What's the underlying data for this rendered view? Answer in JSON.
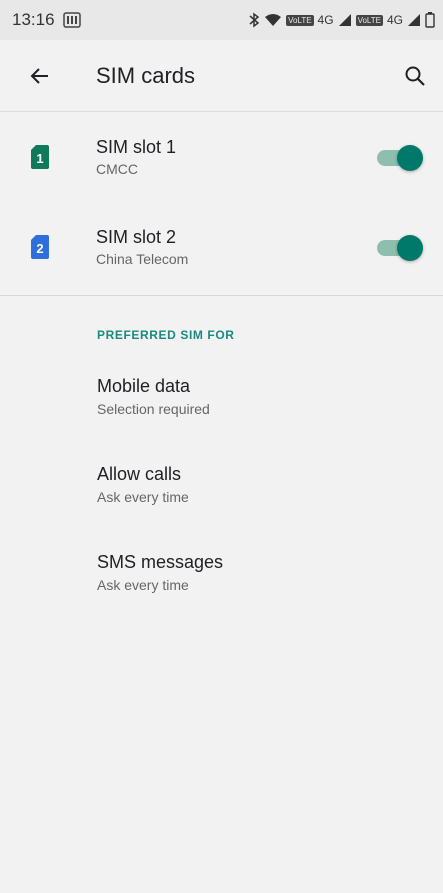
{
  "status_bar": {
    "time": "13:16",
    "network_labels": [
      "4G",
      "4G"
    ],
    "volte_labels": [
      "VoLTE",
      "VoLTE"
    ]
  },
  "app_bar": {
    "title": "SIM cards",
    "back_icon": "arrow-back-icon",
    "search_icon": "search-icon"
  },
  "sims": [
    {
      "slot_number": "1",
      "title": "SIM slot 1",
      "carrier": "CMCC",
      "color": "#0f7a5a",
      "enabled": true
    },
    {
      "slot_number": "2",
      "title": "SIM slot 2",
      "carrier": "China Telecom",
      "color": "#2f6fdc",
      "enabled": true
    }
  ],
  "preferred": {
    "header": "PREFERRED SIM FOR",
    "items": [
      {
        "title": "Mobile data",
        "subtitle": "Selection required"
      },
      {
        "title": "Allow calls",
        "subtitle": "Ask every time"
      },
      {
        "title": "SMS messages",
        "subtitle": "Ask every time"
      }
    ]
  },
  "colors": {
    "accent": "#00796b",
    "section_header": "#1a8a7d",
    "background": "#f2f2f2"
  }
}
